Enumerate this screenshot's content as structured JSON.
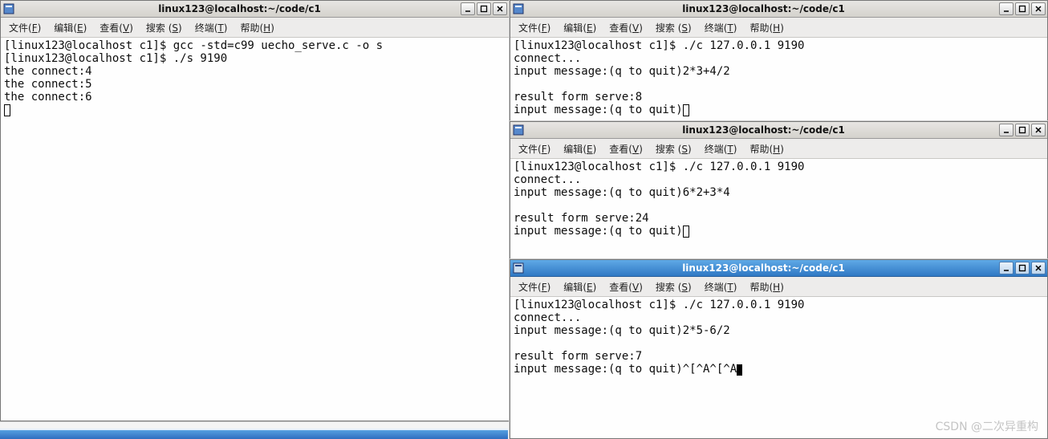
{
  "menus": {
    "file": {
      "label": "文件",
      "accel": "F"
    },
    "edit": {
      "label": "编辑",
      "accel": "E"
    },
    "view": {
      "label": "查看",
      "accel": "V"
    },
    "search": {
      "label": "搜索 ",
      "accel": "S"
    },
    "term": {
      "label": "终端",
      "accel": "T"
    },
    "help": {
      "label": "帮助",
      "accel": "H"
    }
  },
  "windows": {
    "server": {
      "title": "linux123@localhost:~/code/c1",
      "lines": [
        "[linux123@localhost c1]$ gcc -std=c99 uecho_serve.c -o s",
        "[linux123@localhost c1]$ ./s 9190",
        "the connect:4",
        "the connect:5",
        "the connect:6"
      ]
    },
    "client1": {
      "title": "linux123@localhost:~/code/c1",
      "lines": [
        "[linux123@localhost c1]$ ./c 127.0.0.1 9190",
        "connect...",
        "input message:(q to quit)2*3+4/2",
        "",
        "result form serve:8",
        "input message:(q to quit)"
      ]
    },
    "client2": {
      "title": "linux123@localhost:~/code/c1",
      "lines": [
        "[linux123@localhost c1]$ ./c 127.0.0.1 9190",
        "connect...",
        "input message:(q to quit)6*2+3*4",
        "",
        "result form serve:24",
        "input message:(q to quit)"
      ]
    },
    "client3": {
      "title": "linux123@localhost:~/code/c1",
      "lines": [
        "[linux123@localhost c1]$ ./c 127.0.0.1 9190",
        "connect...",
        "input message:(q to quit)2*5-6/2",
        "",
        "result form serve:7",
        "input message:(q to quit)^[^A^[^A"
      ]
    }
  },
  "watermark": "CSDN @二次异重构"
}
